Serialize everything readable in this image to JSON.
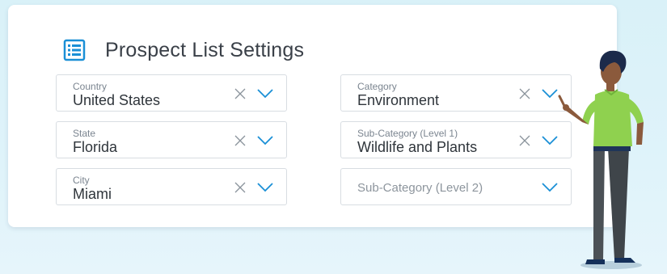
{
  "header": {
    "title": "Prospect List Settings",
    "icon": "list-icon"
  },
  "colors": {
    "accent": "#1a8fd6",
    "background": "#dcf2f9",
    "card": "#ffffff",
    "shirt": "#8fd14f"
  },
  "left_fields": [
    {
      "label": "Country",
      "value": "United States"
    },
    {
      "label": "State",
      "value": "Florida"
    },
    {
      "label": "City",
      "value": "Miami"
    }
  ],
  "right_fields": [
    {
      "label": "Category",
      "value": "Environment"
    },
    {
      "label": "Sub-Category (Level 1)",
      "value": "Wildlife and Plants"
    },
    {
      "placeholder": "Sub-Category (Level 2)"
    }
  ]
}
